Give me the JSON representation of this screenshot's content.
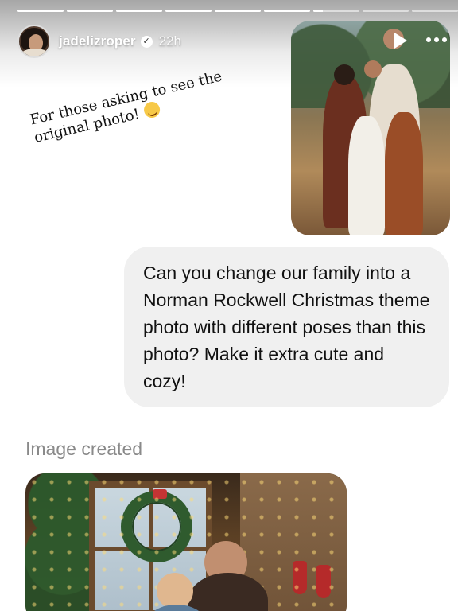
{
  "story": {
    "progress": {
      "segments": [
        1,
        1,
        1,
        1,
        1,
        1,
        0.2,
        0,
        0
      ],
      "accent": "#ffffff"
    },
    "header": {
      "username": "jadelizroper",
      "verified_icon": "verified-badge-icon",
      "time": "22h",
      "play_icon": "play-icon",
      "more_icon": "more-icon"
    },
    "caption": {
      "text": "For those asking to see the original photo!",
      "emoji": "smiling-face-with-hearts-icon"
    },
    "chat": {
      "message": "Can you change our family into a Norman Rockwell Christmas theme photo with different poses than this photo? Make it extra cute and cozy!"
    },
    "result_label": "Image created",
    "images": {
      "top": "family-photo",
      "bottom": "generated-christmas-photo"
    }
  }
}
